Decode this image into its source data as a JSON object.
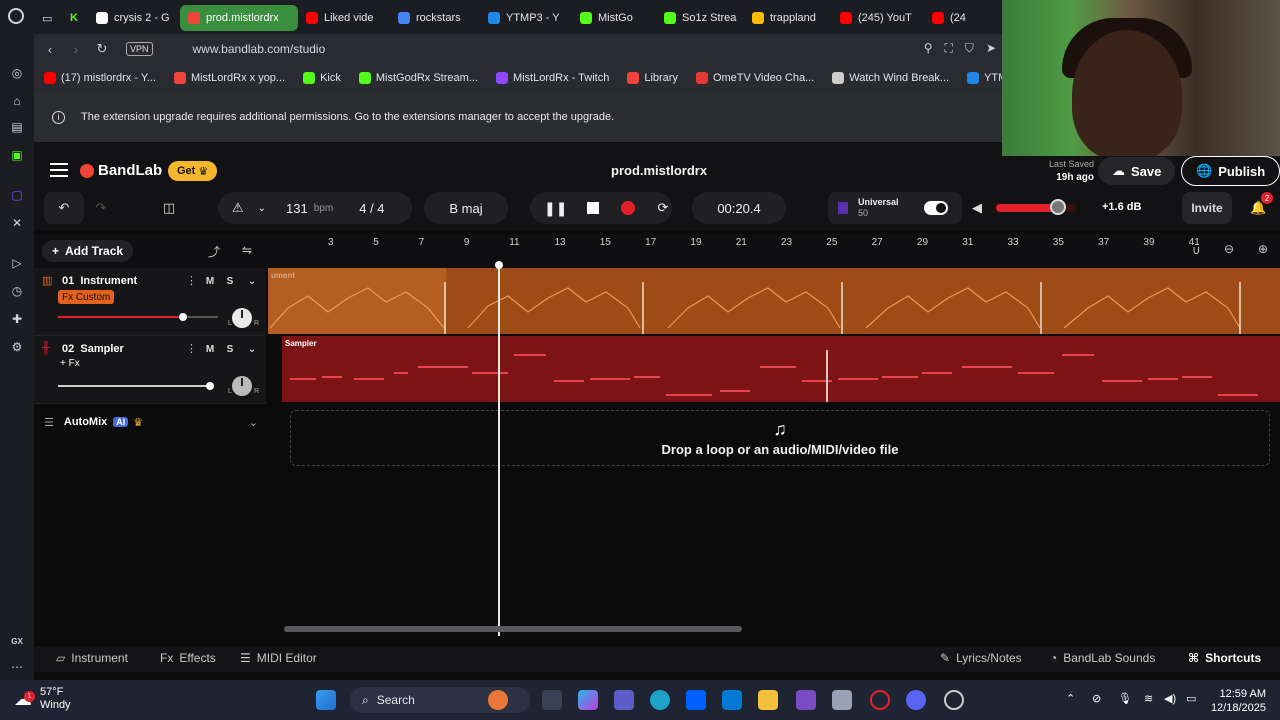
{
  "browser": {
    "tabs": [
      {
        "label": "crysis 2 - G",
        "color": "#ffffff"
      },
      {
        "label": "prod.mistlordrx",
        "color": "#f0433a",
        "active": true
      },
      {
        "label": "Liked vide",
        "color": "#ff0000"
      },
      {
        "label": "rockstars",
        "color": "#4285f4"
      },
      {
        "label": "YTMP3 - Y",
        "color": "#1e88e5"
      },
      {
        "label": "MistGo",
        "color": "#53fc18"
      },
      {
        "label": "So1z Strea",
        "color": "#53fc18"
      },
      {
        "label": "trappland",
        "color": "#fbbc04"
      },
      {
        "label": "(245) YouT",
        "color": "#ff0000"
      },
      {
        "label": "(24",
        "color": "#ff0000"
      }
    ],
    "vpn_label": "VPN",
    "url": "www.bandlab.com/studio",
    "bookmarks": [
      {
        "label": "(17) mistlordrx - Y...",
        "color": "#ff0000"
      },
      {
        "label": "MistLordRx x yop...",
        "color": "#f0433a"
      },
      {
        "label": "Kick",
        "color": "#53fc18"
      },
      {
        "label": "MistGodRx Stream...",
        "color": "#53fc18"
      },
      {
        "label": "MistLordRx - Twitch",
        "color": "#9146ff"
      },
      {
        "label": "Library",
        "color": "#f0433a"
      },
      {
        "label": "OmeTV Video Cha...",
        "color": "#e53935"
      },
      {
        "label": "Watch Wind Break...",
        "color": "#cccccc"
      },
      {
        "label": "YTMP3 - Yo",
        "color": "#1e88e5"
      }
    ],
    "notice": "The extension upgrade requires additional permissions. Go to the extensions manager to accept the upgrade."
  },
  "header": {
    "brand": "BandLab",
    "get_label": "Get",
    "project_title": "prod.mistlordrx",
    "last_saved_label": "Last Saved",
    "last_saved_value": "19h ago",
    "save_label": "Save",
    "publish_label": "Publish"
  },
  "transport": {
    "bpm": "131",
    "bpm_unit": "bpm",
    "time_signature": "4 / 4",
    "key": "B maj",
    "time": "00:20.4",
    "universal_label": "Universal",
    "universal_value": "50",
    "volume_db": "+1.6 dB",
    "volume_level": 0.78,
    "invite_label": "Invite",
    "notification_count": "2"
  },
  "toolbar": {
    "add_track_label": "Add Track",
    "ruler": [
      "3",
      "5",
      "7",
      "9",
      "11",
      "13",
      "15",
      "17",
      "19",
      "21",
      "23",
      "25",
      "27",
      "29",
      "31",
      "33",
      "35",
      "37",
      "39",
      "41"
    ]
  },
  "tracks": [
    {
      "number": "01",
      "name": "Instrument",
      "fx": "Fx Custom",
      "clip_label": "ument",
      "mute": "M",
      "solo": "S",
      "volume": 0.78,
      "pan_l": "L",
      "pan_r": "R"
    },
    {
      "number": "02",
      "name": "Sampler",
      "fx": "+ Fx",
      "clip_label": "Sampler",
      "mute": "M",
      "solo": "S",
      "volume": 0.99,
      "pan_l": "L",
      "pan_r": "R"
    }
  ],
  "automix": {
    "label": "AutoMix",
    "badge": "AI"
  },
  "dropzone": {
    "text": "Drop a loop or an audio/MIDI/video file"
  },
  "bottom": {
    "instrument": "Instrument",
    "effects_prefix": "Fx",
    "effects": "Effects",
    "midi_editor": "MIDI Editor",
    "lyrics": "Lyrics/Notes",
    "sounds": "BandLab Sounds",
    "shortcuts": "Shortcuts"
  },
  "taskbar": {
    "temperature": "57°F",
    "weather": "Windy",
    "weather_badge": "1",
    "search_placeholder": "Search",
    "time": "12:59 AM",
    "date": "12/18/2025"
  },
  "colors": {
    "track1": "#9f4b16",
    "track2": "#7c1416",
    "accent": "#f0433a",
    "get": "#f5b72d"
  }
}
